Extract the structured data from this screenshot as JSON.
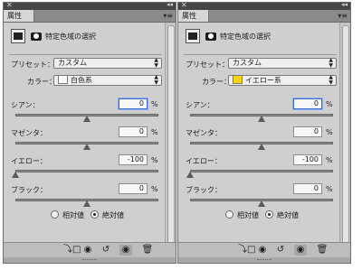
{
  "panels": [
    {
      "tab_label": "属性",
      "selective_color_title": "特定色域の選択",
      "preset_label": "プリセット：",
      "preset_value": "カスタム",
      "colors_label": "カラー：",
      "colors_value": "白色系",
      "swatch_color": "#ffffff",
      "sliders": [
        {
          "label": "シアン：",
          "value": "0",
          "unit": "%",
          "level": 0
        },
        {
          "label": "マゼンタ：",
          "value": "0",
          "unit": "%",
          "level": 0
        },
        {
          "label": "イエロー：",
          "value": "-100",
          "unit": "%",
          "level": -100
        },
        {
          "label": "ブラック：",
          "value": "0",
          "unit": "%",
          "level": 0
        }
      ],
      "relative_label": "相対値",
      "absolute_label": "絶対値",
      "method_selected": "absolute"
    },
    {
      "tab_label": "属性",
      "selective_color_title": "特定色域の選択",
      "preset_label": "プリセット：",
      "preset_value": "カスタム",
      "colors_label": "カラー：",
      "colors_value": "イエロー系",
      "swatch_color": "#ffd200",
      "sliders": [
        {
          "label": "シアン：",
          "value": "0",
          "unit": "%",
          "level": 0
        },
        {
          "label": "マゼンタ：",
          "value": "0",
          "unit": "%",
          "level": 0
        },
        {
          "label": "イエロー：",
          "value": "-100",
          "unit": "%",
          "level": -100
        },
        {
          "label": "ブラック：",
          "value": "0",
          "unit": "%",
          "level": 0
        }
      ],
      "relative_label": "相対値",
      "absolute_label": "絶対値",
      "method_selected": "absolute"
    }
  ],
  "bottom_icons": [
    "clip-to-layer-icon",
    "view-previous-state-icon",
    "reset-icon",
    "visibility-eye-icon",
    "trash-icon"
  ],
  "colors": {
    "focus_border": "#3a6fd0",
    "panel_bg": "#cfcfcf",
    "header_bg": "#464646"
  }
}
